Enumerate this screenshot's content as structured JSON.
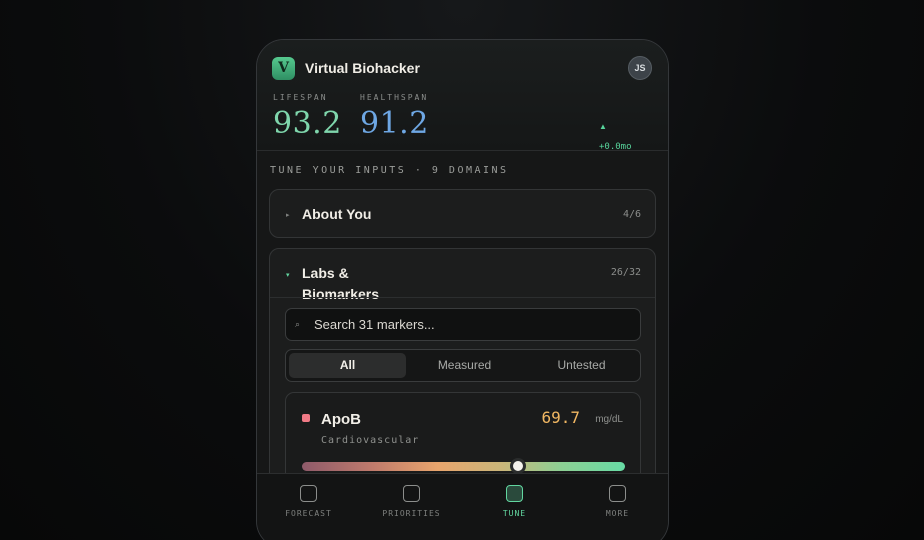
{
  "app": {
    "logo_letter": "V",
    "title": "Virtual Biohacker",
    "avatar_initials": "JS"
  },
  "stats": {
    "lifespan": {
      "label": "LIFESPAN",
      "value": "93.2",
      "color": "#7fd6ac"
    },
    "healthspan": {
      "label": "HEALTHSPAN",
      "value": "91.2",
      "color": "#6ea7e4"
    },
    "delta_arrow": "▲",
    "delta": "+0.0mo"
  },
  "section": {
    "title": "TUNE YOUR INPUTS · 9 DOMAINS"
  },
  "domains": [
    {
      "caret": "▸",
      "title": "About You",
      "count": "4/6",
      "expanded": false
    },
    {
      "caret": "▾",
      "title": "Labs & Biomarkers",
      "count": "26/32",
      "expanded": true
    }
  ],
  "labs": {
    "search_icon": "⌕",
    "search_placeholder": "Search 31 markers...",
    "filters": [
      {
        "label": "All",
        "active": true
      },
      {
        "label": "Measured",
        "active": false
      },
      {
        "label": "Untested",
        "active": false
      }
    ],
    "marker": {
      "name": "ApoB",
      "category": "Cardiovascular",
      "value": "69.7",
      "unit": "mg/dL",
      "status_color": "#f07a86",
      "value_color": "#f2b863",
      "slider_fraction": 0.67
    }
  },
  "nav": [
    {
      "label": "FORECAST",
      "icon": "forecast-icon",
      "active": false
    },
    {
      "label": "PRIORITIES",
      "icon": "priorities-icon",
      "active": false
    },
    {
      "label": "TUNE",
      "icon": "tune-icon",
      "active": true
    },
    {
      "label": "MORE",
      "icon": "more-icon",
      "active": false
    }
  ]
}
